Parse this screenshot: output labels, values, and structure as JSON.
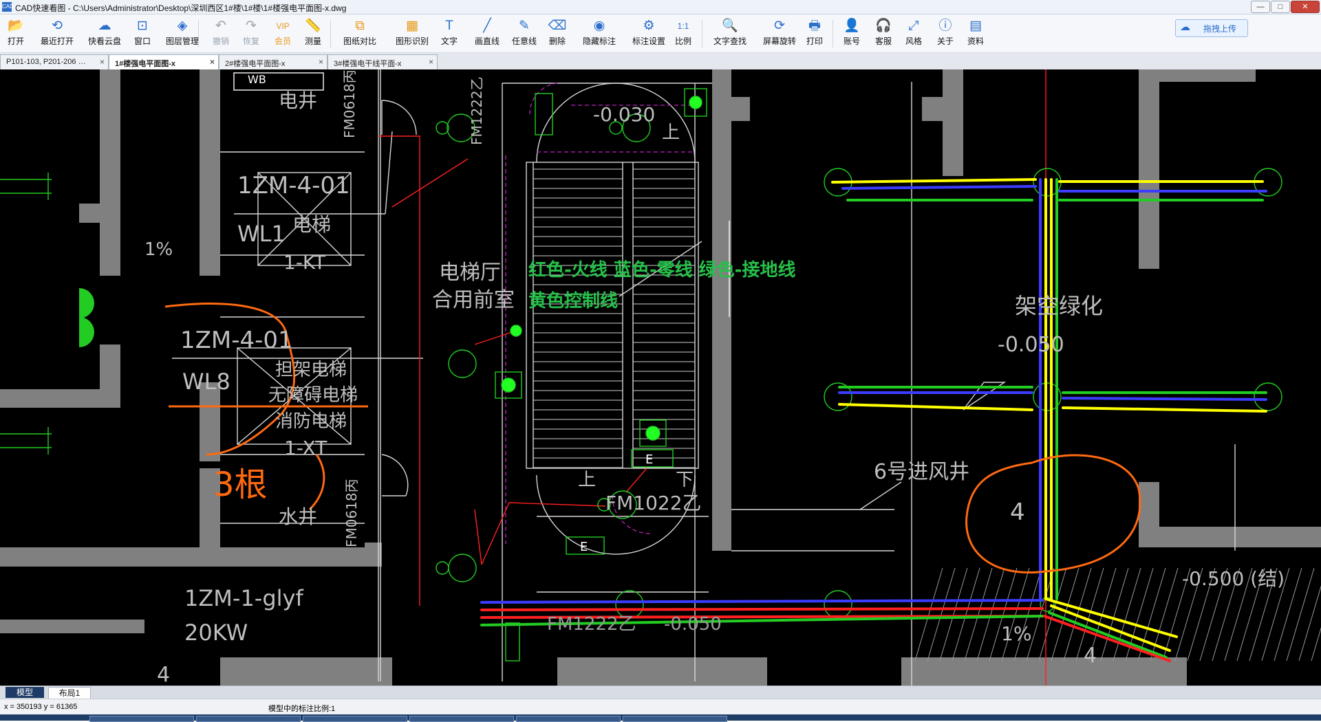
{
  "window": {
    "app_name": "CAD快速看图",
    "title": "CAD快速看图 - C:\\Users\\Administrator\\Desktop\\深圳西区1#楼\\1#楼\\1#楼强电平面图-x.dwg",
    "controls": [
      "—",
      "□",
      "✕"
    ]
  },
  "toolbar": [
    {
      "label": "打开",
      "icon": "folder-open-icon",
      "glyph": "📂"
    },
    {
      "label": "最近打开",
      "icon": "recent-icon",
      "glyph": "⟲"
    },
    {
      "label": "快看云盘",
      "icon": "cloud-icon",
      "glyph": "☁"
    },
    {
      "label": "窗口",
      "icon": "window-icon",
      "glyph": "⊡"
    },
    {
      "label": "图层管理",
      "icon": "layers-icon",
      "glyph": "◈"
    },
    {
      "label": "撤销",
      "icon": "undo-icon",
      "glyph": "↶"
    },
    {
      "label": "恢复",
      "icon": "redo-icon",
      "glyph": "↷"
    },
    {
      "label": "会员",
      "icon": "vip-icon",
      "glyph": "VIP"
    },
    {
      "label": "测量",
      "icon": "measure-icon",
      "glyph": "📏"
    },
    {
      "label": "图纸对比",
      "icon": "compare-icon",
      "glyph": "⧉"
    },
    {
      "label": "图形识别",
      "icon": "shape-recognition-icon",
      "glyph": "▦"
    },
    {
      "label": "文字",
      "icon": "text-icon",
      "glyph": "T"
    },
    {
      "label": "画直线",
      "icon": "line-icon",
      "glyph": "╱"
    },
    {
      "label": "任意线",
      "icon": "freehand-icon",
      "glyph": "✎"
    },
    {
      "label": "删除",
      "icon": "eraser-icon",
      "glyph": "⌫"
    },
    {
      "label": "隐藏标注",
      "icon": "hide-annotation-icon",
      "glyph": "◉"
    },
    {
      "label": "标注设置",
      "icon": "annotation-settings-icon",
      "glyph": "⚙"
    },
    {
      "label": "比例",
      "icon": "scale-icon",
      "glyph": "1:1"
    },
    {
      "label": "文字查找",
      "icon": "text-search-icon",
      "glyph": "🔍"
    },
    {
      "label": "屏幕旋转",
      "icon": "rotate-screen-icon",
      "glyph": "⟳"
    },
    {
      "label": "打印",
      "icon": "print-icon",
      "glyph": "🖶"
    },
    {
      "label": "账号",
      "icon": "account-icon",
      "glyph": "👤"
    },
    {
      "label": "客服",
      "icon": "headset-icon",
      "glyph": "🎧"
    },
    {
      "label": "风格",
      "icon": "style-icon",
      "glyph": "⤢"
    },
    {
      "label": "关于",
      "icon": "info-icon",
      "glyph": "ⓘ"
    },
    {
      "label": "资料",
      "icon": "materials-icon",
      "glyph": "▤"
    }
  ],
  "upload_button": {
    "label": "拖拽上传",
    "icon": "cloud-upload-icon"
  },
  "tabs": [
    {
      "label": "P101-103, P201-206 …",
      "active": false
    },
    {
      "label": "1#楼强电平面图-x",
      "active": true
    },
    {
      "label": "2#楼强电平面图-x",
      "active": false
    },
    {
      "label": "3#楼强电干线平面-x",
      "active": false
    }
  ],
  "tab_close_glyph": "×",
  "drawing": {
    "legend_line1": "红色-火线  蓝色-零线  绿色-接地线",
    "legend_line2": "黄色控制线",
    "labels": {
      "wb": "WB",
      "shaft_top": "电井",
      "fm_top": "FM0618丙",
      "zm401": "1ZM-4-01",
      "wl1": "WL1",
      "elevator": "电梯",
      "kt": "1-KT",
      "slope1": "1%",
      "zm401b": "1ZM-4-01",
      "wl8": "WL8",
      "fire_elev1": "担架电梯",
      "fire_elev2": "无障碍电梯",
      "fire_elev3": "消防电梯",
      "xt": "1-XT",
      "handwritten": "3根",
      "water_well": "水井",
      "fm_bottom": "FM0618丙",
      "lobby1": "电梯厅",
      "lobby2": "合用前室",
      "fm1222_top": "FM1222乙",
      "level_top": "-0.030",
      "up_top": "上",
      "sky_green": "架空绿化",
      "level_right": "-0.050",
      "vent": "6号进风井",
      "four_mid": "4",
      "fm1022": "FM1022乙",
      "up_bottom": "上",
      "down_bottom": "下",
      "e_box": "E",
      "e_box_bottom": "E",
      "zm_glyf": "1ZM-1-glyf",
      "kw": "20KW",
      "fm1222_bottom": "FM1222乙",
      "level_bottom": "-0.050",
      "slope2": "1%",
      "four_right": "4",
      "level_struct": "-0.500 (结)",
      "four_left": "4"
    },
    "wire_colors": {
      "live": "#ff2020",
      "neutral": "#3c3cff",
      "ground": "#22cc22",
      "control": "#ffff00",
      "wall": "#808080",
      "annotation": "#ff6a10",
      "legend": "#27c04a"
    }
  },
  "layout_tabs": [
    "模型",
    "布局1"
  ],
  "status": {
    "coordinates": "x = 350193  y = 61365",
    "annotation_scale": "模型中的标注比例:1"
  }
}
